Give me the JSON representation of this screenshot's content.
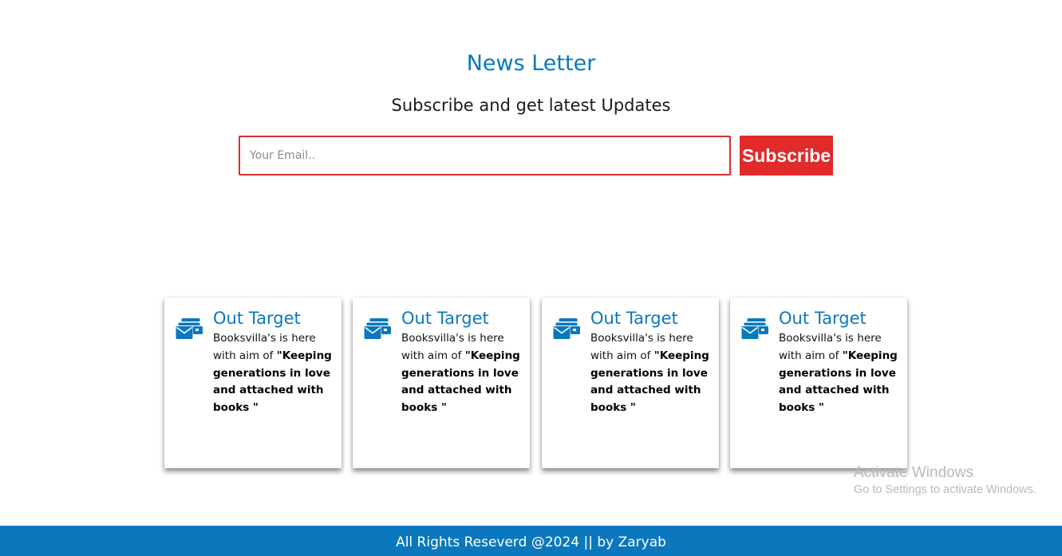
{
  "newsletter": {
    "title": "News Letter",
    "subtitle": "Subscribe and get latest Updates",
    "email_placeholder": "Your Email..",
    "subscribe_label": "Subscribe"
  },
  "cards": [
    {
      "icon": "envelopes-icon",
      "title": "Out Target",
      "text_lead": "Booksvilla's is here with aim of ",
      "text_bold": "\"Keeping generations in love and attached with books \""
    },
    {
      "icon": "envelopes-icon",
      "title": "Out Target",
      "text_lead": "Booksvilla's is here with aim of ",
      "text_bold": "\"Keeping generations in love and attached with books \""
    },
    {
      "icon": "envelopes-icon",
      "title": "Out Target",
      "text_lead": "Booksvilla's is here with aim of ",
      "text_bold": "\"Keeping generations in love and attached with books \""
    },
    {
      "icon": "envelopes-icon",
      "title": "Out Target",
      "text_lead": "Booksvilla's is here with aim of ",
      "text_bold": "\"Keeping generations in love and attached with books \""
    }
  ],
  "watermark": {
    "title": "Activate Windows",
    "subtitle": "Go to Settings to activate Windows."
  },
  "footer": {
    "text": "All Rights Reseverd @2024 || by Zaryab"
  },
  "colors": {
    "accent": "#0b78bd",
    "button": "#e12a2a",
    "input_border": "#d32f2f"
  }
}
